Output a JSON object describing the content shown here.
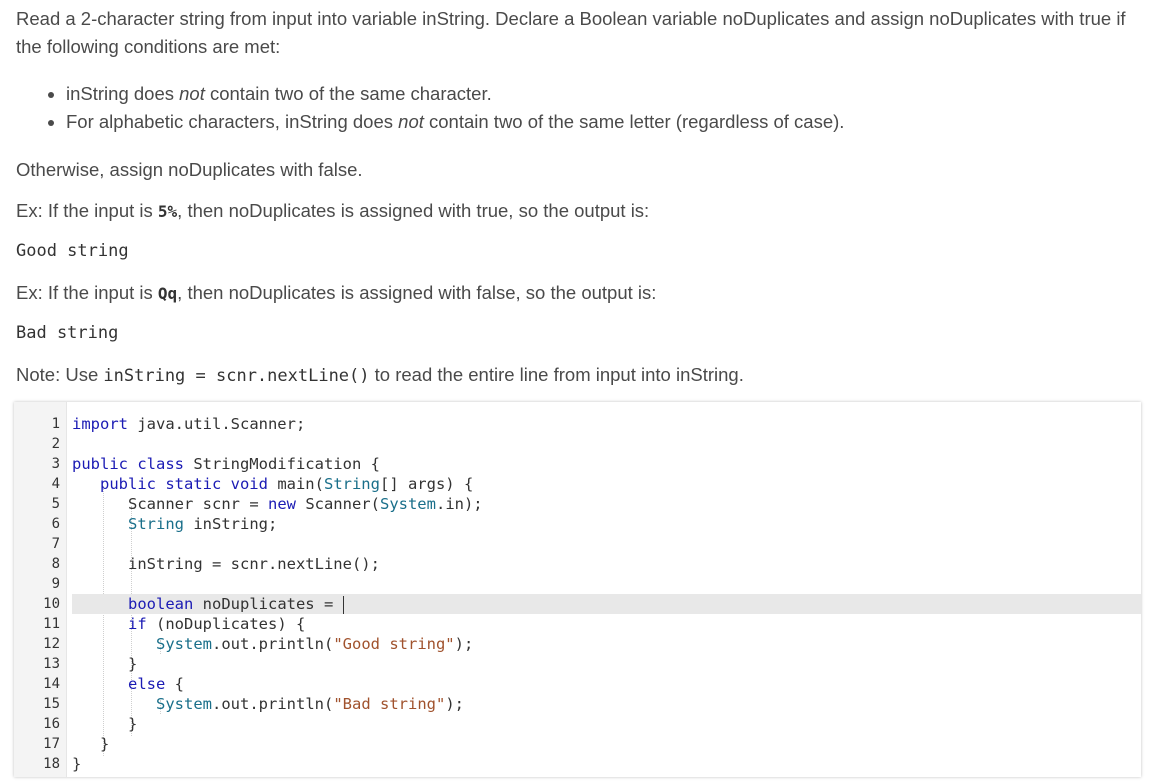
{
  "prompt": {
    "intro": "Read a 2-character string from input into variable inString. Declare a Boolean variable noDuplicates and assign noDuplicates with true if the following conditions are met:",
    "bullet1_a": "inString does ",
    "bullet1_em": "not",
    "bullet1_b": " contain two of the same character.",
    "bullet2_a": "For alphabetic characters, inString does ",
    "bullet2_em": "not",
    "bullet2_b": " contain two of the same letter (regardless of case).",
    "otherwise": "Otherwise, assign noDuplicates with false.",
    "ex1_a": "Ex: If the input is ",
    "ex1_input": "5%",
    "ex1_b": ", then noDuplicates is assigned with true, so the output is:",
    "ex1_output": "Good string",
    "ex2_a": "Ex: If the input is ",
    "ex2_input": "Qq",
    "ex2_b": ", then noDuplicates is assigned with false, so the output is:",
    "ex2_output": "Bad string",
    "note_a": "Note: Use ",
    "note_code": "inString = scnr.nextLine()",
    "note_b": " to read the entire line from input into inString."
  },
  "editor": {
    "line_numbers": [
      "1",
      "2",
      "3",
      "4",
      "5",
      "6",
      "7",
      "8",
      "9",
      "10",
      "11",
      "12",
      "13",
      "14",
      "15",
      "16",
      "17",
      "18"
    ],
    "active_line": 10,
    "code": {
      "l1_kw": "import",
      "l1_rest": " java.util.Scanner;",
      "l3_kw": "public class",
      "l3_rest": " StringModification {",
      "l4_kw": "public static void",
      "l4_mid": " main(",
      "l4_ty": "String",
      "l4_rest": "[] args) {",
      "l5_a": "Scanner scnr = ",
      "l5_kw": "new",
      "l5_b": " Scanner(",
      "l5_ty": "System",
      "l5_c": ".in);",
      "l6_ty": "String",
      "l6_rest": " inString;",
      "l8": "inString = scnr.nextLine();",
      "l10_kw": "boolean",
      "l10_rest": " noDuplicates = ",
      "l11_kw": "if",
      "l11_rest": " (noDuplicates) {",
      "l12_ty": "System",
      "l12_a": ".out.println(",
      "l12_str": "\"Good string\"",
      "l12_b": ");",
      "l13": "}",
      "l14_kw": "else",
      "l14_rest": " {",
      "l15_ty": "System",
      "l15_a": ".out.println(",
      "l15_str": "\"Bad string\"",
      "l15_b": ");",
      "l16": "}",
      "l17": "}",
      "l18": "}"
    }
  }
}
